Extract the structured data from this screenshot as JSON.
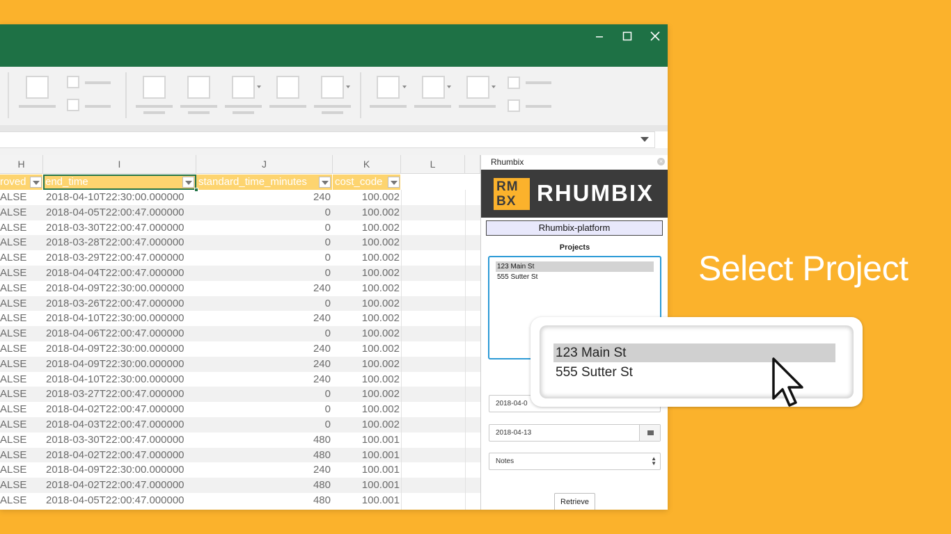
{
  "window": {
    "controls": {
      "minimize": "—",
      "maximize": "☐",
      "close": "✕"
    }
  },
  "sheet": {
    "column_letters": [
      "H",
      "I",
      "J",
      "K",
      "L"
    ],
    "header_row": [
      "roved",
      "end_time",
      "standard_time_minutes",
      "cost_code"
    ],
    "rows": [
      [
        "ALSE",
        "2018-04-10T22:30:00.000000",
        "240",
        "100.002"
      ],
      [
        "ALSE",
        "2018-04-05T22:00:47.000000",
        "0",
        "100.002"
      ],
      [
        "ALSE",
        "2018-03-30T22:00:47.000000",
        "0",
        "100.002"
      ],
      [
        "ALSE",
        "2018-03-28T22:00:47.000000",
        "0",
        "100.002"
      ],
      [
        "ALSE",
        "2018-03-29T22:00:47.000000",
        "0",
        "100.002"
      ],
      [
        "ALSE",
        "2018-04-04T22:00:47.000000",
        "0",
        "100.002"
      ],
      [
        "ALSE",
        "2018-04-09T22:30:00.000000",
        "240",
        "100.002"
      ],
      [
        "ALSE",
        "2018-03-26T22:00:47.000000",
        "0",
        "100.002"
      ],
      [
        "ALSE",
        "2018-04-10T22:30:00.000000",
        "240",
        "100.002"
      ],
      [
        "ALSE",
        "2018-04-06T22:00:47.000000",
        "0",
        "100.002"
      ],
      [
        "ALSE",
        "2018-04-09T22:30:00.000000",
        "240",
        "100.002"
      ],
      [
        "ALSE",
        "2018-04-09T22:30:00.000000",
        "240",
        "100.002"
      ],
      [
        "ALSE",
        "2018-04-10T22:30:00.000000",
        "240",
        "100.002"
      ],
      [
        "ALSE",
        "2018-03-27T22:00:47.000000",
        "0",
        "100.002"
      ],
      [
        "ALSE",
        "2018-04-02T22:00:47.000000",
        "0",
        "100.002"
      ],
      [
        "ALSE",
        "2018-04-03T22:00:47.000000",
        "0",
        "100.002"
      ],
      [
        "ALSE",
        "2018-03-30T22:00:47.000000",
        "480",
        "100.001"
      ],
      [
        "ALSE",
        "2018-04-02T22:00:47.000000",
        "480",
        "100.001"
      ],
      [
        "ALSE",
        "2018-04-09T22:30:00.000000",
        "240",
        "100.001"
      ],
      [
        "ALSE",
        "2018-04-02T22:00:47.000000",
        "480",
        "100.001"
      ],
      [
        "ALSE",
        "2018-04-05T22:00:47.000000",
        "480",
        "100.001"
      ]
    ]
  },
  "pane": {
    "title": "Rhumbix",
    "close_glyph": "×",
    "logo_mark_top": "RM",
    "logo_mark_bottom": "BX",
    "logo_text": "RHUMBIX",
    "platform": "Rhumbix-platform",
    "projects_label": "Projects",
    "projects": [
      "123 Main St",
      "555 Sutter St"
    ],
    "selected_project": "123 Main St",
    "start_date": "2018-04-0",
    "end_date": "2018-04-13",
    "notes_select": "Notes",
    "retrieve_label": "Retrieve"
  },
  "zoom_callout": {
    "items": [
      "123 Main St",
      "555 Sutter St"
    ],
    "selected": "123 Main St"
  },
  "headline": "Select Project",
  "colors": {
    "background": "#fbb22c",
    "titlebar": "#1e7145",
    "header_fill": "#fdd46f",
    "selection": "#217346",
    "focus_border": "#2b9ad6",
    "logo_bar": "#3b3b3b"
  }
}
